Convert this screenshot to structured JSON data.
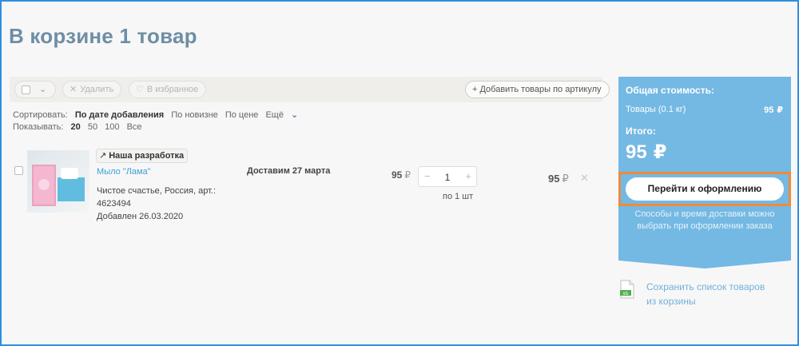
{
  "page_title": "В корзине 1 товар",
  "toolbar": {
    "delete_label": "Удалить",
    "favorites_label": "В избранное",
    "add_by_article_label": "+ Добавить товары по артикулу"
  },
  "sort": {
    "label": "Сортировать:",
    "options": [
      "По дате добавления",
      "По новизне",
      "По цене"
    ],
    "more": "Ещё"
  },
  "show": {
    "label": "Показывать:",
    "options": [
      "20",
      "50",
      "100",
      "Все"
    ]
  },
  "item": {
    "badge": "Наша разработка",
    "name": "Мыло \"Лама\"",
    "description": "Чистое счастье, Россия, арт.: 4623494",
    "added": "Добавлен 26.03.2020",
    "delivery": "Доставим 27 марта",
    "unit_price": "95",
    "quantity": "1",
    "per_unit": "по 1 шт",
    "total_price": "95",
    "currency": "₽"
  },
  "summary": {
    "title": "Общая стоимость:",
    "goods_label": "Товары (0.1 кг)",
    "goods_price": "95",
    "total_label": "Итого:",
    "total": "95",
    "currency": "₽",
    "checkout_label": "Перейти к оформлению",
    "note": "Способы и время доставки можно выбрать при оформлении заказа"
  },
  "save_list_label": "Сохранить список товаров из корзины",
  "xls_label": "xls",
  "colors": {
    "frame_border": "#2f8fe0",
    "title": "#6d8fa4",
    "summary_bg": "#74b9e3",
    "highlight": "#f08a3a",
    "link": "#3d9fd4"
  }
}
